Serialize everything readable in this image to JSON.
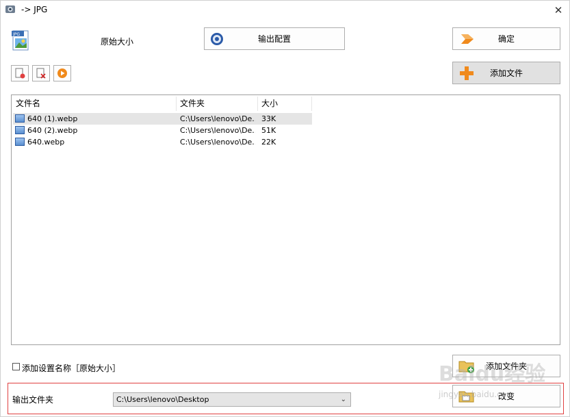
{
  "window": {
    "title": "-> JPG",
    "close_glyph": "✕"
  },
  "top": {
    "original_size_label": "原始大小",
    "output_config_label": "输出配置",
    "ok_label": "确定",
    "add_file_label": "添加文件"
  },
  "list": {
    "headers": [
      "文件名",
      "文件夹",
      "大小"
    ],
    "rows": [
      {
        "name": "640 (1).webp",
        "folder": "C:\\Users\\lenovo\\De...",
        "size": "33K"
      },
      {
        "name": "640 (2).webp",
        "folder": "C:\\Users\\lenovo\\De...",
        "size": "51K"
      },
      {
        "name": "640.webp",
        "folder": "C:\\Users\\lenovo\\De...",
        "size": "22K"
      }
    ]
  },
  "bottom": {
    "add_setting_name_label": "添加设置名称［原始大小］",
    "add_folder_label": "添加文件夹",
    "output_folder_label": "输出文件夹",
    "output_folder_value": "C:\\Users\\lenovo\\Desktop",
    "change_label": "改变"
  },
  "watermark": {
    "text": "Baidu经验",
    "sub": "jingyan.baidu.com"
  },
  "icons": [
    "app-icon",
    "jpg-file-icon",
    "gear-icon",
    "arrow-right-icon",
    "plus-icon",
    "add-file-icon",
    "delete-file-icon",
    "play-icon",
    "image-file-icon",
    "folder-add-icon",
    "folder-icon",
    "chevron-down-icon"
  ],
  "colors": {
    "accent_orange": "#f08a1c",
    "highlight_border": "#e04040",
    "selected_row": "#e5e5e5"
  }
}
